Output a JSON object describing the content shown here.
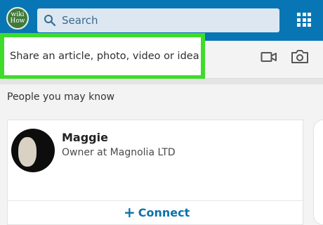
{
  "header": {
    "logo_line1": "wiki",
    "logo_line2": "How",
    "search_placeholder": "Search",
    "grid_icon": "apps-grid-icon"
  },
  "share": {
    "prompt": "Share an article, photo, video or idea",
    "video_icon": "video-camera-icon",
    "photo_icon": "camera-icon"
  },
  "pymk": {
    "title": "People you may know",
    "person": {
      "name": "Maggie",
      "title": "Owner at Magnolia LTD",
      "action_symbol": "+",
      "action_label": "Connect"
    }
  },
  "colors": {
    "header": "#0876b4",
    "highlight": "#3ddc2a",
    "connect": "#0a72ad"
  }
}
